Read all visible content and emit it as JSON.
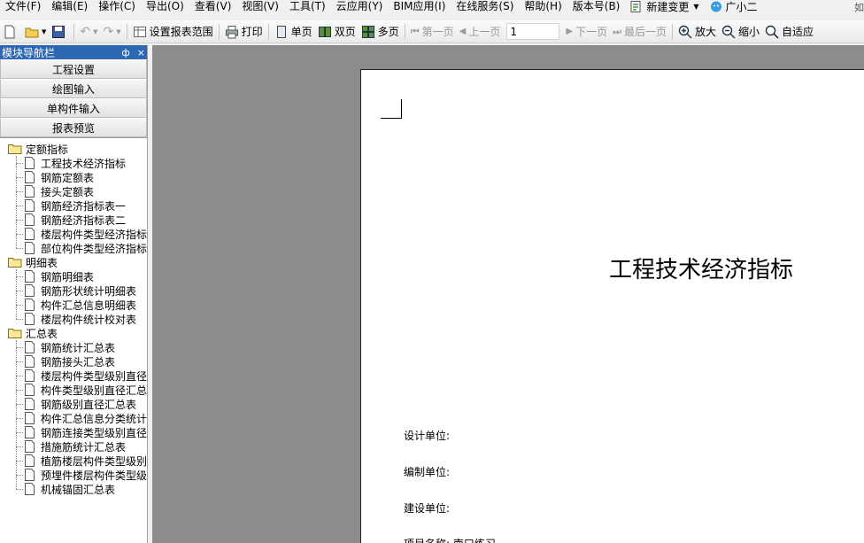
{
  "menu": {
    "items": [
      "文件(F)",
      "编辑(E)",
      "操作(C)",
      "导出(O)",
      "查看(V)",
      "视图(V)",
      "工具(T)",
      "云应用(Y)",
      "BIM应用(I)",
      "在线服务(S)",
      "帮助(H)",
      "版本号(B)"
    ],
    "new_change": "新建变更",
    "assistant": "广小二",
    "corner_text": "如"
  },
  "toolbar": {
    "set_range": "设置报表范围",
    "print": "打印",
    "single_page": "单页",
    "double_page": "双页",
    "multi_page": "多页",
    "first_page": "第一页",
    "prev_page": "上一页",
    "page_value": "1",
    "next_page": "下一页",
    "last_page": "最后一页",
    "zoom_in": "放大",
    "zoom_out": "缩小",
    "fit": "自适应"
  },
  "panel": {
    "title": "模块导航栏",
    "pin": "ф",
    "close": "×",
    "nav_buttons": [
      "工程设置",
      "绘图输入",
      "单构件输入",
      "报表预览"
    ]
  },
  "tree": [
    {
      "label": "定额指标",
      "children": [
        "工程技术经济指标",
        "钢筋定额表",
        "接头定额表",
        "钢筋经济指标表一",
        "钢筋经济指标表二",
        "楼层构件类型经济指标",
        "部位构件类型经济指标"
      ]
    },
    {
      "label": "明细表",
      "children": [
        "钢筋明细表",
        "钢筋形状统计明细表",
        "构件汇总信息明细表",
        "楼层构件统计校对表"
      ]
    },
    {
      "label": "汇总表",
      "children": [
        "钢筋统计汇总表",
        "钢筋接头汇总表",
        "楼层构件类型级别直径",
        "构件类型级别直径汇总",
        "钢筋级别直径汇总表",
        "构件汇总信息分类统计",
        "钢筋连接类型级别直径",
        "措施筋统计汇总表",
        "植筋楼层构件类型级别",
        "预埋件楼层构件类型级",
        "机械锚固汇总表"
      ]
    }
  ],
  "report": {
    "title": "工程技术经济指标",
    "design_unit": "设计单位:",
    "compile_unit": "编制单位:",
    "build_unit": "建设单位:",
    "project_name": "项目名称: 南口练习"
  }
}
